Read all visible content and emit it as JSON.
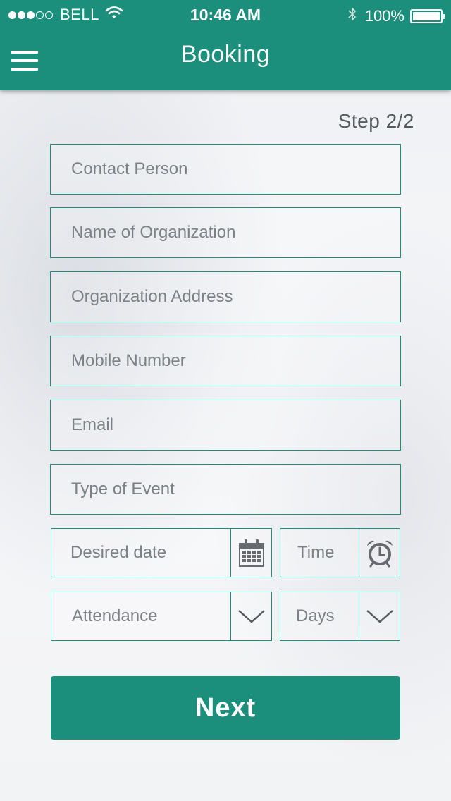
{
  "status_bar": {
    "carrier": "BELL",
    "time": "10:46 AM",
    "battery": "100%"
  },
  "header": {
    "title": "Booking"
  },
  "step": "Step 2/2",
  "form": {
    "contact_person": {
      "placeholder": "Contact Person"
    },
    "organization_name": {
      "placeholder": "Name of Organization"
    },
    "organization_address": {
      "placeholder": "Organization Address"
    },
    "mobile_number": {
      "placeholder": "Mobile Number"
    },
    "email": {
      "placeholder": "Email"
    },
    "event_type": {
      "placeholder": "Type of Event"
    },
    "desired_date": {
      "placeholder": "Desired date",
      "icon": "calendar-icon"
    },
    "time": {
      "placeholder": "Time",
      "icon": "alarm-clock-icon"
    },
    "attendance": {
      "placeholder": "Attendance",
      "icon": "chevron-down-icon"
    },
    "days": {
      "placeholder": "Days",
      "icon": "chevron-down-icon"
    }
  },
  "next_button": "Next",
  "colors": {
    "accent": "#1b8f7b",
    "placeholder": "#7c8186"
  }
}
